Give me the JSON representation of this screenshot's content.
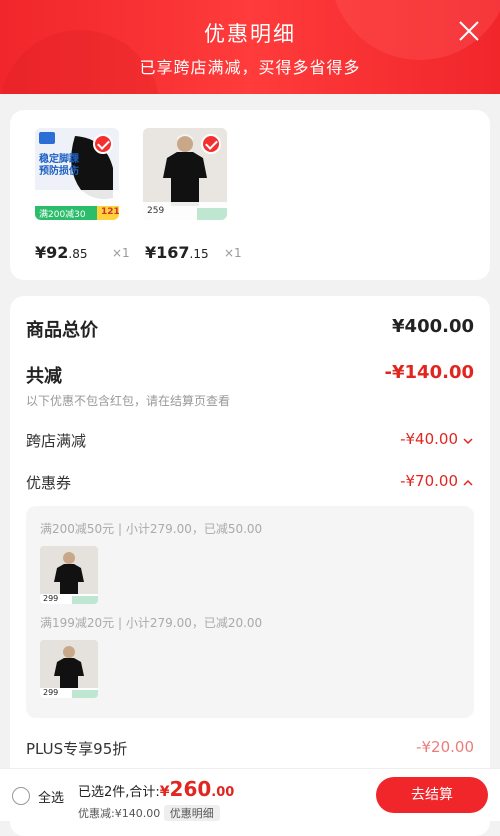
{
  "header": {
    "title": "优惠明细",
    "subtitle": "已享跨店满减，买得多省得多",
    "close_icon": "close-icon"
  },
  "products": [
    {
      "name": "ankle-support-product",
      "img_title_lines": [
        "稳定脚踝",
        "预防损伤"
      ],
      "img_promo_badge": "满200减30",
      "img_price_badge": "121",
      "price_int": "¥92",
      "price_dec": ".85",
      "qty": "×1"
    },
    {
      "name": "tshirt-product",
      "img_price_badge": "259",
      "price_int": "¥167",
      "price_dec": ".15",
      "qty": "×1"
    }
  ],
  "summary": {
    "total_label": "商品总价",
    "total_value": "¥400.00",
    "discount_label": "共减",
    "discount_value": "-¥140.00",
    "discount_note": "以下优惠不包含红包，请在结算页查看",
    "cross_store_label": "跨店满减",
    "cross_store_value": "-¥40.00",
    "coupon_label": "优惠券",
    "coupon_value": "-¥70.00",
    "coupons": [
      {
        "text": "满200减50元 | 小计279.00，已减50.00",
        "thumb_price": "299"
      },
      {
        "text": "满199减20元 | 小计279.00，已减20.00",
        "thumb_price": "299"
      }
    ],
    "plus_label": "PLUS专享95折",
    "plus_value": "-¥20.00"
  },
  "footer": {
    "select_all": "全选",
    "selected_prefix": "已选2件,合计:",
    "total_symbol": "¥",
    "total_int": "260",
    "total_dec": ".00",
    "saved": "优惠减:¥140.00",
    "detail_tag": "优惠明细",
    "checkout": "去结算"
  },
  "colors": {
    "accent": "#f0262b",
    "price_red": "#e0261f"
  }
}
